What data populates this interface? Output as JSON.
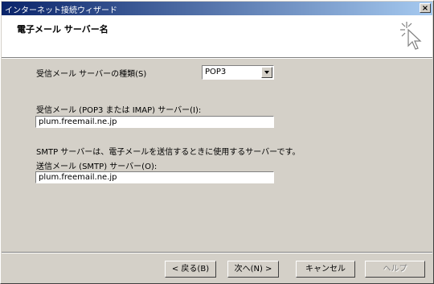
{
  "window": {
    "title": "インターネット接続ウィザード",
    "close_label": "×"
  },
  "header": {
    "title": "電子メール サーバー名"
  },
  "form": {
    "server_type_label": "受信メール サーバーの種類(S)",
    "server_type_value": "POP3",
    "incoming_label": "受信メール (POP3 または IMAP) サーバー(I):",
    "incoming_value": "plum.freemail.ne.jp",
    "smtp_description": "SMTP サーバーは、電子メールを送信するときに使用するサーバーです。",
    "outgoing_label": "送信メール (SMTP) サーバー(O):",
    "outgoing_value": "plum.freemail.ne.jp"
  },
  "buttons": {
    "back": "< 戻る(B)",
    "next": "次へ(N) >",
    "cancel": "キャンセル",
    "help": "ヘルプ"
  },
  "icons": {
    "wizard": "wizard-cursor-icon",
    "dropdown": "chevron-down-icon"
  }
}
